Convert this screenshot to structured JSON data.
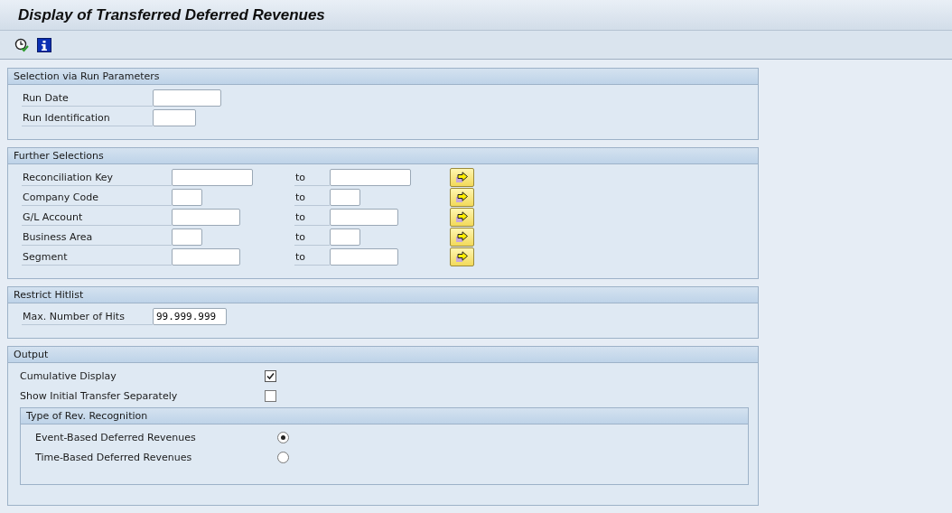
{
  "window": {
    "title": "Display of Transferred Deferred Revenues"
  },
  "toolbar": [
    {
      "kind": "execute"
    },
    {
      "kind": "info"
    }
  ],
  "run_parameters": {
    "title": "Selection via Run Parameters",
    "fields": [
      {
        "label": "Run Date",
        "kind": "medium"
      },
      {
        "label": "Run Identification",
        "kind": "short"
      }
    ]
  },
  "further_selections": {
    "title": "Further Selections",
    "rows": [
      {
        "label": "Reconciliation Key",
        "kind": "long",
        "to_label": "to"
      },
      {
        "label": "Company Code",
        "kind": "tiny",
        "to_label": "to"
      },
      {
        "label": "G/L Account",
        "kind": "medium",
        "to_label": "to"
      },
      {
        "label": "Business Area",
        "kind": "tiny",
        "to_label": "to"
      },
      {
        "label": "Segment",
        "kind": "medium",
        "to_label": "to"
      }
    ]
  },
  "restrict_hitlist": {
    "title": "Restrict Hitlist",
    "fields": [
      {
        "label": "Max. Number of Hits",
        "value": "99.999.999",
        "kind": "wide"
      }
    ]
  },
  "output": {
    "title": "Output",
    "checkboxes": [
      {
        "label": "Cumulative Display",
        "checked": true
      },
      {
        "label": "Show Initial Transfer Separately",
        "checked": false
      }
    ],
    "recognition": {
      "title": "Type of Rev. Recognition",
      "options": [
        {
          "label": "Event-Based Deferred Revenues",
          "selected": true
        },
        {
          "label": "Time-Based Deferred Revenues",
          "selected": false
        }
      ]
    }
  }
}
